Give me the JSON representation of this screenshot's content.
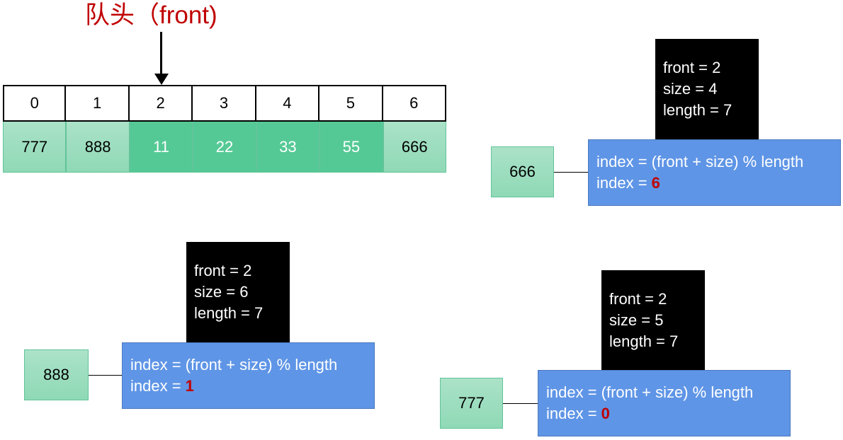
{
  "title": "队头（front)",
  "array": {
    "indices": [
      "0",
      "1",
      "2",
      "3",
      "4",
      "5",
      "6"
    ],
    "values": [
      "777",
      "888",
      "11",
      "22",
      "33",
      "55",
      "666"
    ],
    "highlighted": [
      false,
      false,
      true,
      true,
      true,
      true,
      false
    ]
  },
  "colors": {
    "title": "#c00000",
    "occupied": "#55c995",
    "enqueued": "#9fdfc0",
    "formula_box": "#5f95e6",
    "index_highlight": "#c00000"
  },
  "steps": [
    {
      "front": "front = 2",
      "size": "size = 4",
      "length": "length = 7",
      "formula": "index = (front + size) % length",
      "index_label": "index = ",
      "index_value": "6",
      "value": "666"
    },
    {
      "front": "front = 2",
      "size": "size = 6",
      "length": "length = 7",
      "formula": "index = (front + size) % length",
      "index_label": "index = ",
      "index_value": "1",
      "value": "888"
    },
    {
      "front": "front = 2",
      "size": "size = 5",
      "length": "length = 7",
      "formula": "index = (front + size) % length",
      "index_label": "index = ",
      "index_value": "0",
      "value": "777"
    }
  ]
}
